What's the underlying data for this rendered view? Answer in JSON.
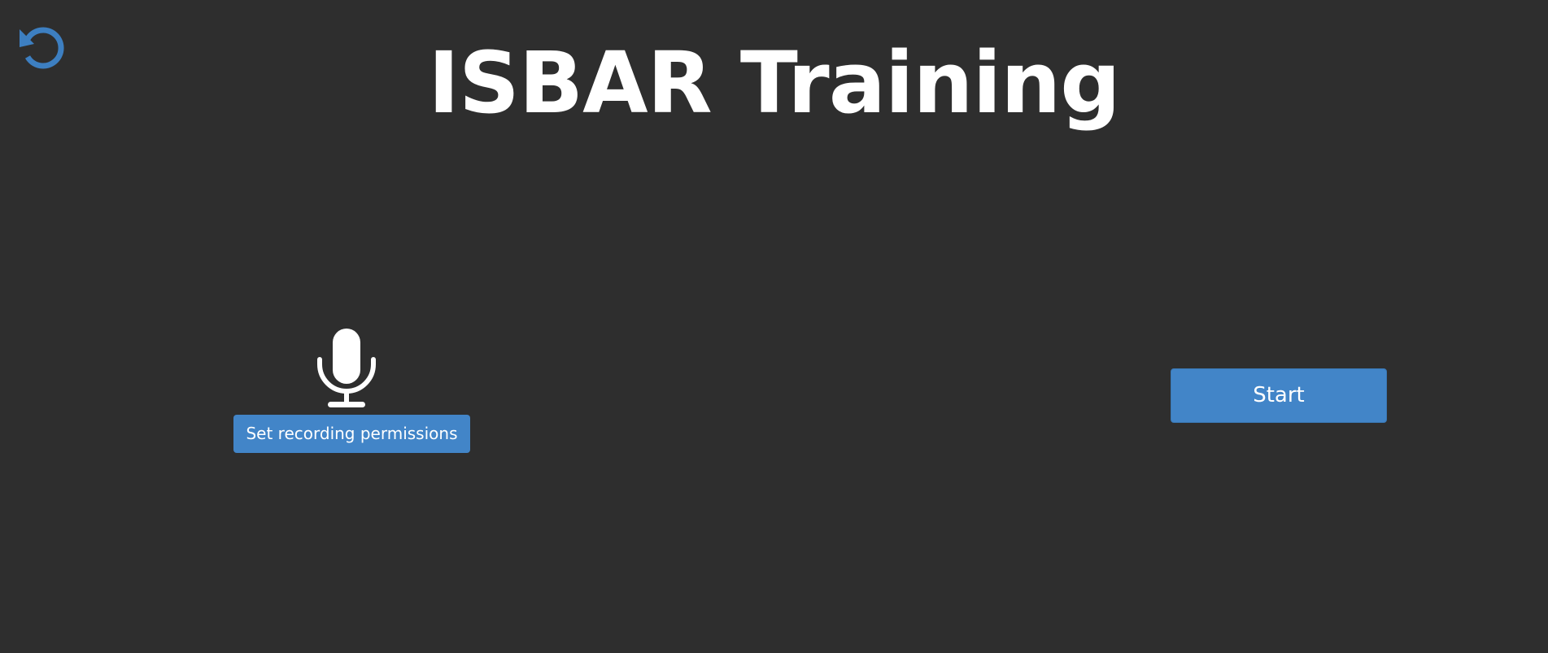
{
  "page": {
    "title": "ISBAR Training"
  },
  "toolbar": {
    "reset_icon": "rotate-left-icon"
  },
  "recording": {
    "icon": "microphone-icon",
    "permissions_label": "Set recording permissions"
  },
  "actions": {
    "start_label": "Start"
  },
  "colors": {
    "background": "#2e2e2e",
    "accent": "#4285c8",
    "text": "#ffffff"
  }
}
